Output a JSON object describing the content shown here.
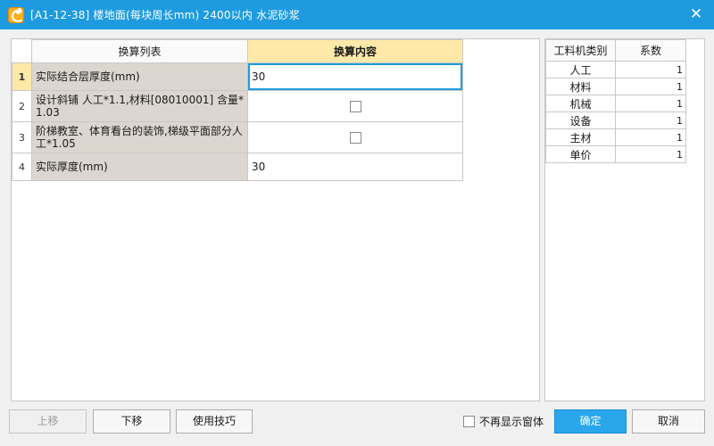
{
  "window": {
    "title": "[A1-12-38] 楼地面(每块周长mm) 2400以内 水泥砂浆",
    "close_icon": "close-icon"
  },
  "conversion_table": {
    "headers": {
      "list": "换算列表",
      "content": "换算内容"
    },
    "rows": [
      {
        "num": "1",
        "label": "实际结合层厚度(mm)",
        "value": "30",
        "type": "text",
        "active": true
      },
      {
        "num": "2",
        "label": "设计斜铺 人工*1.1,材料[08010001] 含量*1.03",
        "value": "",
        "type": "checkbox",
        "checked": false
      },
      {
        "num": "3",
        "label": "阶梯教室、体育看台的装饰,梯级平面部分人工*1.05",
        "value": "",
        "type": "checkbox",
        "checked": false
      },
      {
        "num": "4",
        "label": "实际厚度(mm)",
        "value": "30",
        "type": "text"
      }
    ]
  },
  "coefficients": {
    "headers": {
      "category": "工料机类别",
      "factor": "系数"
    },
    "rows": [
      {
        "category": "人工",
        "factor": "1"
      },
      {
        "category": "材料",
        "factor": "1"
      },
      {
        "category": "机械",
        "factor": "1"
      },
      {
        "category": "设备",
        "factor": "1"
      },
      {
        "category": "主材",
        "factor": "1"
      },
      {
        "category": "单价",
        "factor": "1"
      }
    ]
  },
  "footer": {
    "move_up": "上移",
    "move_down": "下移",
    "tips": "使用技巧",
    "dont_show_again": "不再显示窗体",
    "ok": "确定",
    "cancel": "取消"
  },
  "colors": {
    "titlebar": "#1e9be0",
    "header_highlight": "#ffe9a8",
    "label_cell": "#dcd6d0",
    "primary_button": "#2aa6ec"
  }
}
